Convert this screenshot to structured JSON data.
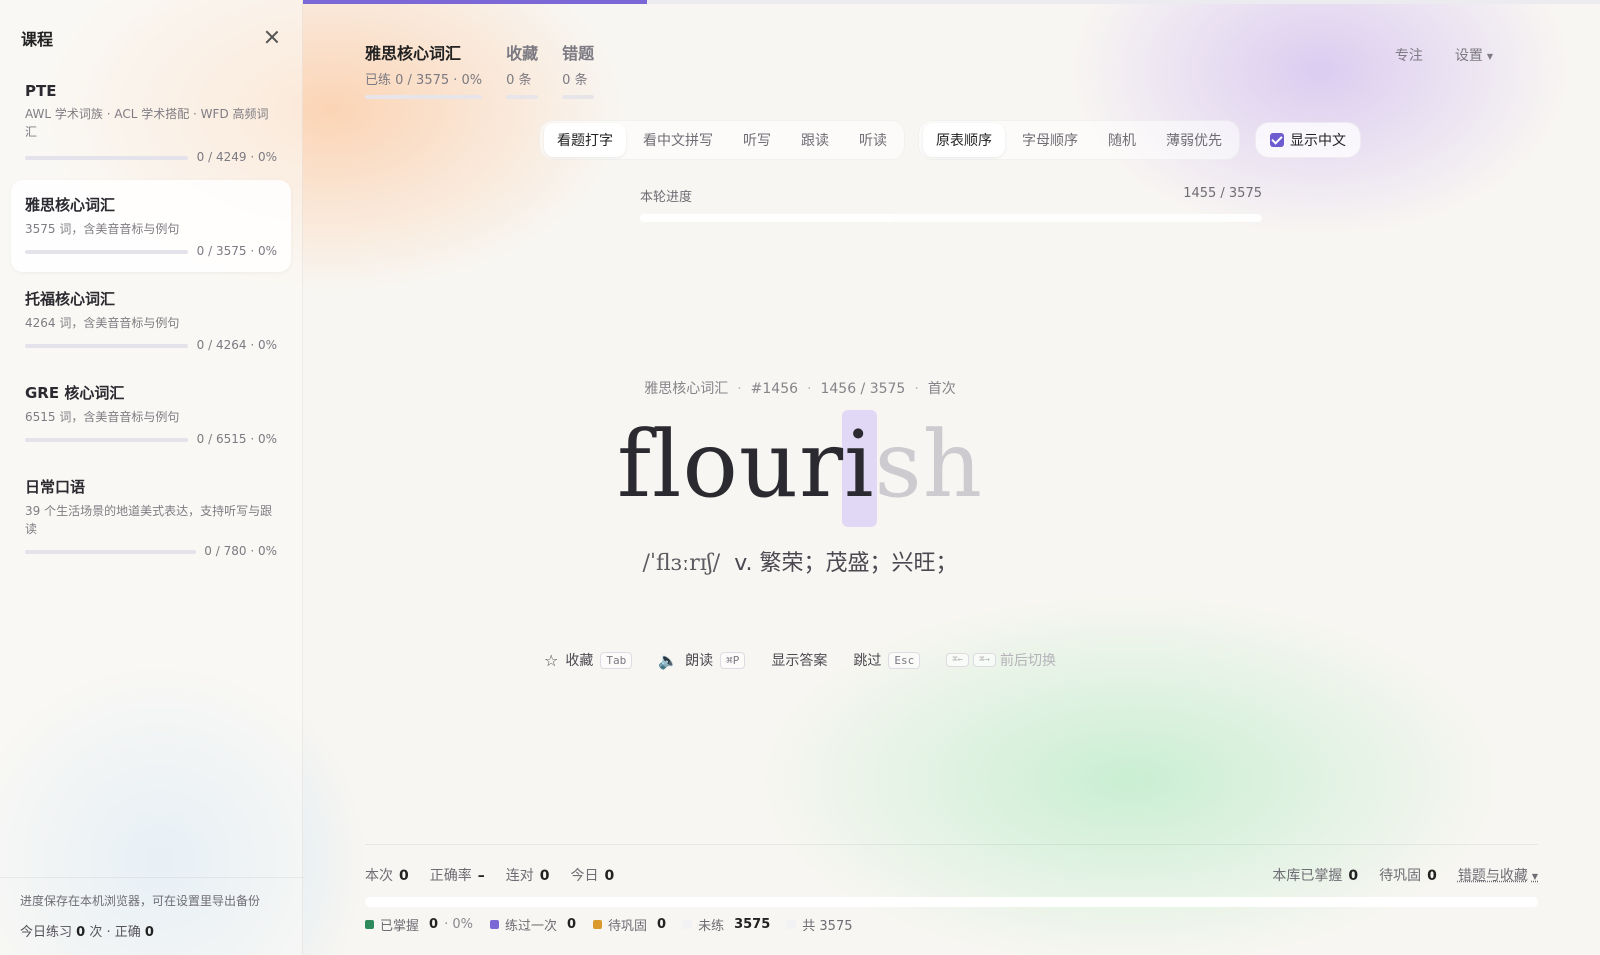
{
  "sidebar": {
    "title": "课程",
    "courses": [
      {
        "name": "PTE",
        "desc": "AWL 学术词族 · ACL 学术搭配 · WFD 高频词汇",
        "stat": "0 / 4249 · 0%"
      },
      {
        "name": "雅思核心词汇",
        "desc": "3575 词，含美音音标与例句",
        "stat": "0 / 3575 · 0%"
      },
      {
        "name": "托福核心词汇",
        "desc": "4264 词，含美音音标与例句",
        "stat": "0 / 4264 · 0%"
      },
      {
        "name": "GRE 核心词汇",
        "desc": "6515 词，含美音音标与例句",
        "stat": "0 / 6515 · 0%"
      },
      {
        "name": "日常口语",
        "desc": "39 个生活场景的地道美式表达，支持听写与跟读",
        "stat": "0 / 780 · 0%"
      }
    ],
    "footer_note": "进度保存在本机浏览器，可在设置里导出备份",
    "today_prefix": "今日练习",
    "today_count": "0",
    "today_mid": "次 · 正确",
    "today_correct": "0"
  },
  "header": {
    "tabs": [
      {
        "label": "雅思核心词汇",
        "sub": "已练 0 / 3575 · 0%"
      },
      {
        "label": "收藏",
        "sub": "0 条"
      },
      {
        "label": "错题",
        "sub": "0 条"
      }
    ],
    "focus": "专注",
    "settings": "设置"
  },
  "modes": [
    "看题打字",
    "看中文拼写",
    "听写",
    "跟读",
    "听读"
  ],
  "orders": [
    "原表顺序",
    "字母顺序",
    "随机",
    "薄弱优先"
  ],
  "show_cn": "显示中文",
  "round": {
    "label": "本轮进度",
    "count": "1455 / 3575",
    "progress": 0.407
  },
  "word": {
    "source": "雅思核心词汇",
    "index": "#1456",
    "position": "1456 / 3575",
    "status": "首次",
    "typed": "flour",
    "current": "i",
    "pending": "sh",
    "phonetic": "/ˈflɜːrɪʃ/",
    "definition": "v. 繁荣；茂盛；兴旺；"
  },
  "actions": {
    "fav": "收藏",
    "fav_key": "Tab",
    "read": "朗读",
    "read_key": "⌘P",
    "answer": "显示答案",
    "skip": "跳过",
    "skip_key": "Esc",
    "prev_key": "⌘←",
    "next_key": "⌘→",
    "switch": "前后切换"
  },
  "stats": {
    "session_label": "本次",
    "session": "0",
    "accuracy_label": "正确率",
    "accuracy": "–",
    "streak_label": "连对",
    "streak": "0",
    "today_label": "今日",
    "today": "0",
    "mastered_label": "本库已掌握",
    "mastered": "0",
    "review_label": "待巩固",
    "review": "0",
    "wrong_fav": "错题与收藏"
  },
  "legend": {
    "mastered_label": "已掌握",
    "mastered": "0",
    "mastered_pct": "· 0%",
    "once_label": "练过一次",
    "once": "0",
    "review_label": "待巩固",
    "review": "0",
    "unpracticed_label": "未练",
    "unpracticed": "3575",
    "total": "共 3575"
  },
  "colors": {
    "accent": "#7b67d6",
    "mastered": "#2e8a5a",
    "once": "#7b67d6",
    "review": "#d99a2b"
  }
}
